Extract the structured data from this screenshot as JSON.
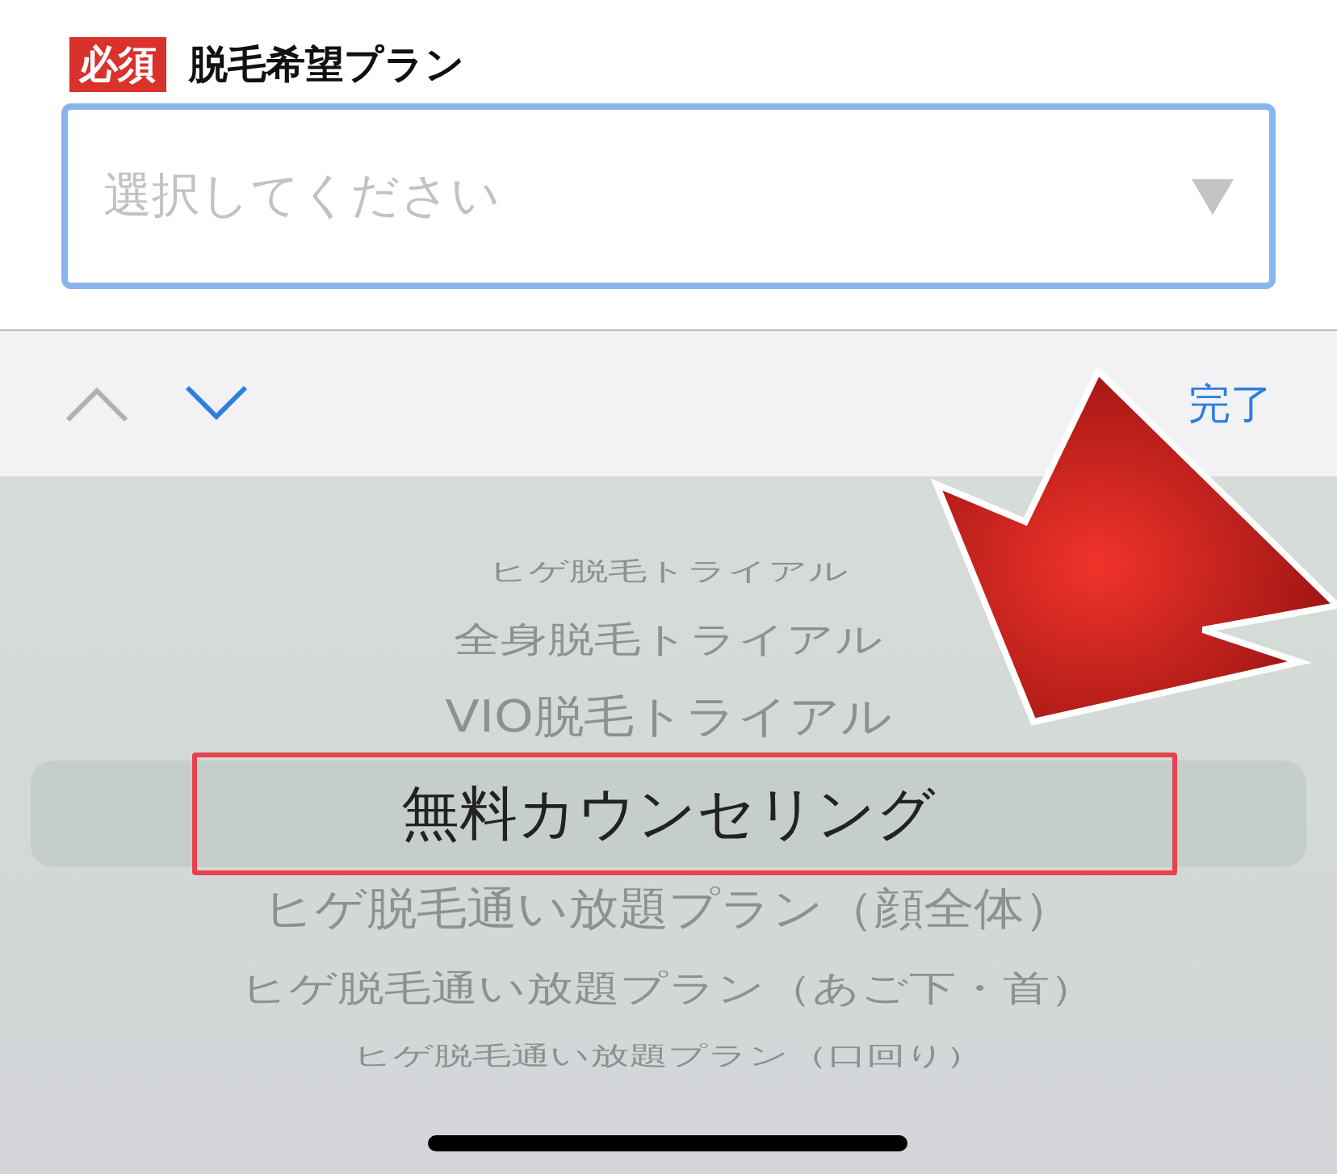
{
  "field": {
    "required_badge": "必須",
    "label": "脱毛希望プラン",
    "placeholder": "選択してください",
    "focused": true
  },
  "toolbar": {
    "done": "完了",
    "prev_enabled": false,
    "next_enabled": true
  },
  "picker": {
    "items": [
      {
        "label": "ヒゲ脱毛トライアル",
        "selected": false
      },
      {
        "label": "全身脱毛トライアル",
        "selected": false
      },
      {
        "label": "VIO脱毛トライアル",
        "selected": false
      },
      {
        "label": "無料カウンセリング",
        "selected": true
      },
      {
        "label": "ヒゲ脱毛通い放題プラン（顔全体）",
        "selected": false
      },
      {
        "label": "ヒゲ脱毛通い放題プラン（あご下・首）",
        "selected": false
      },
      {
        "label": "ヒゲ脱毛通い放題プラン（口回り）",
        "selected": false
      }
    ]
  }
}
